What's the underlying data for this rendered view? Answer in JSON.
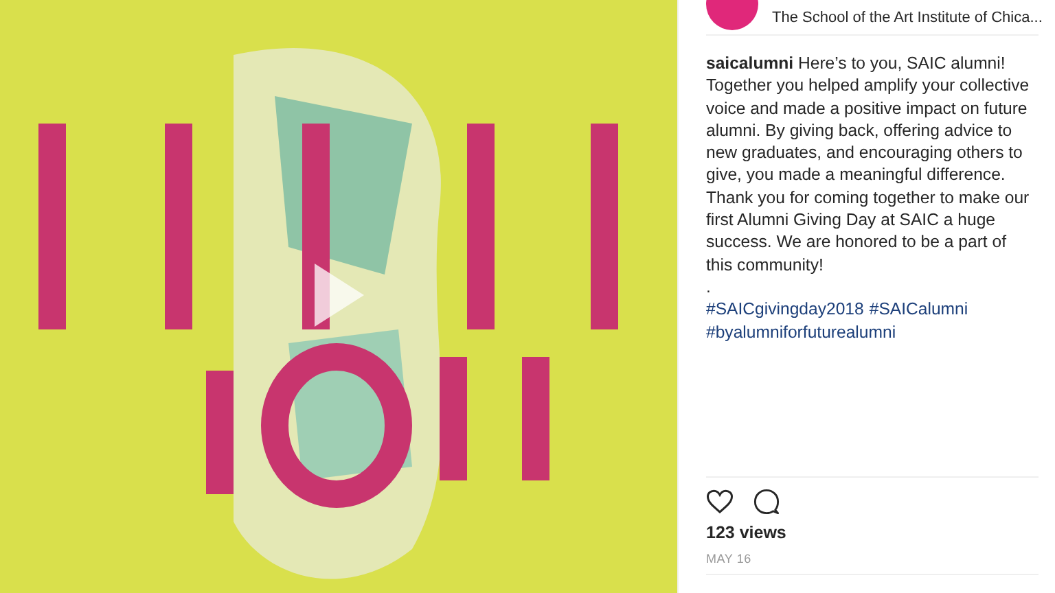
{
  "media": {
    "kind": "picture",
    "playable": true
  },
  "header": {
    "account_name": "The School of the Art Institute of Chica..."
  },
  "caption": {
    "text": "**saicalumni** Here’s to you, SAIC alumni! Together you helped amplify your collective voice and made a positive impact on future alumni. By giving back, offering advice to new graduates, and encouraging others to give, you made a meaningful difference. Thank you for coming together to make our first Alumni Giving Day at SAIC a huge success. We are honored to be a part of this community!",
    "separator": ".",
    "hashtags": [
      "#SAICgivingday2018",
      "#SAICalumni",
      "#byalumniforfuturealumni"
    ]
  },
  "actions": [
    {
      "kind": "like",
      "selected": false
    },
    {
      "kind": "comment"
    }
  ],
  "views": "123 views",
  "date": "MAY 16"
}
